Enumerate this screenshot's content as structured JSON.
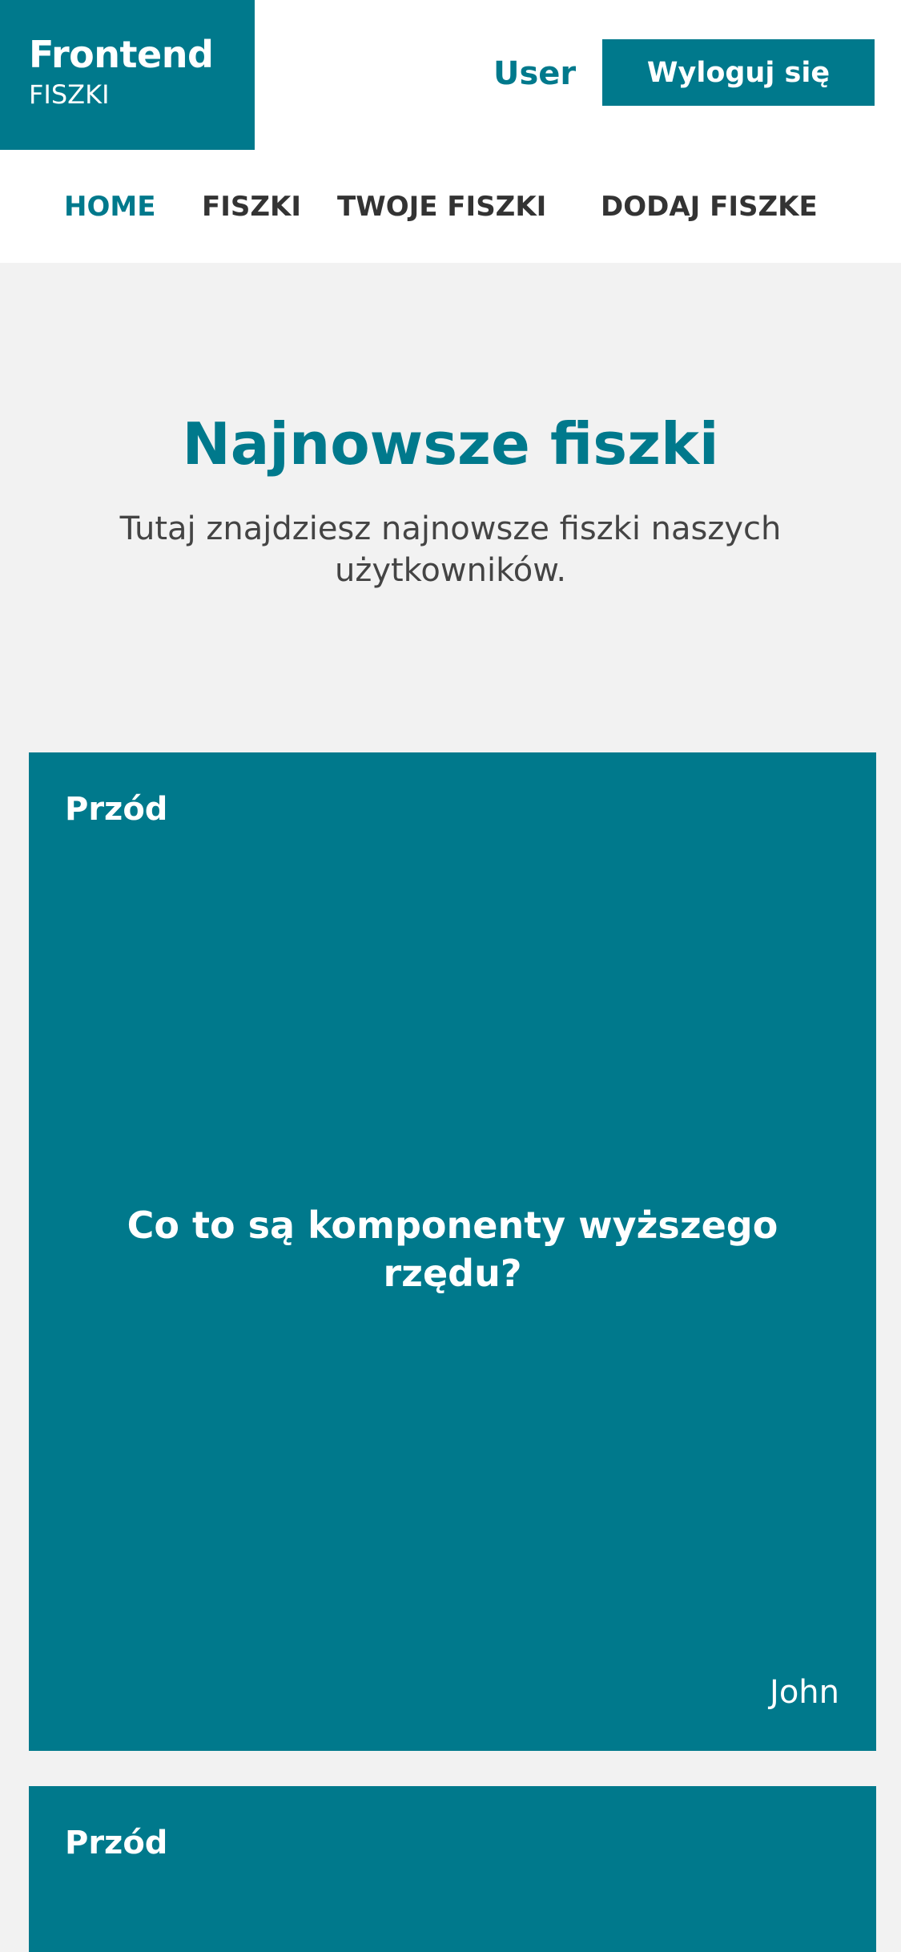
{
  "header": {
    "logo_title": "Frontend",
    "logo_subtitle": "FISZKI",
    "user_label": "User",
    "logout_label": "Wyloguj się"
  },
  "nav": {
    "items": [
      {
        "label": "HOME",
        "active": true
      },
      {
        "label": "FISZKI",
        "active": false
      },
      {
        "label": "TWOJE FISZKI",
        "active": false
      },
      {
        "label": "DODAJ FISZKE",
        "active": false
      }
    ]
  },
  "intro": {
    "title": "Najnowsze fiszki",
    "subtitle": "Tutaj znajdziesz najnowsze fiszki naszych użytkowników."
  },
  "cards": [
    {
      "side": "Przód",
      "question": "Co to są komponenty wyższego rzędu?",
      "author": "John"
    },
    {
      "side": "Przód"
    }
  ],
  "colors": {
    "accent": "#00798c",
    "background": "#f2f2f2",
    "text": "#333333"
  }
}
